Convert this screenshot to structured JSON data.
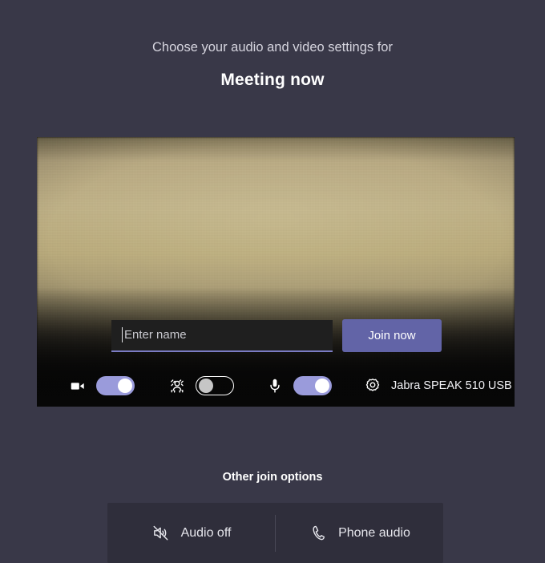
{
  "header": {
    "subtitle": "Choose your audio and video settings for",
    "title": "Meeting now"
  },
  "video_preview": {
    "icon": "camera-preview",
    "description": "Blurred beige wall camera preview"
  },
  "join": {
    "name_input": {
      "value": "",
      "placeholder": "Enter name",
      "icon": "text-caret"
    },
    "join_button_label": "Join now"
  },
  "devices": {
    "camera": {
      "icon": "video-camera-icon",
      "state": "on",
      "label": "Camera"
    },
    "background_blur": {
      "icon": "background-blur-icon",
      "state": "off",
      "label": "Background blur"
    },
    "microphone": {
      "icon": "microphone-icon",
      "state": "on",
      "label": "Microphone"
    },
    "settings": {
      "icon": "gear-icon",
      "device_name": "Jabra SPEAK 510 USB"
    }
  },
  "other_join": {
    "title": "Other join options",
    "options": [
      {
        "label": "Audio off",
        "icon": "speaker-muted-icon"
      },
      {
        "label": "Phone audio",
        "icon": "phone-icon"
      }
    ]
  },
  "colors": {
    "page_background": "#393848",
    "accent_purple": "#6264a7",
    "toggle_on": "#9a9bdb",
    "panel_background": "#2f2e3b",
    "input_background": "#1f1f1f",
    "input_underline": "#7b7cc4"
  }
}
